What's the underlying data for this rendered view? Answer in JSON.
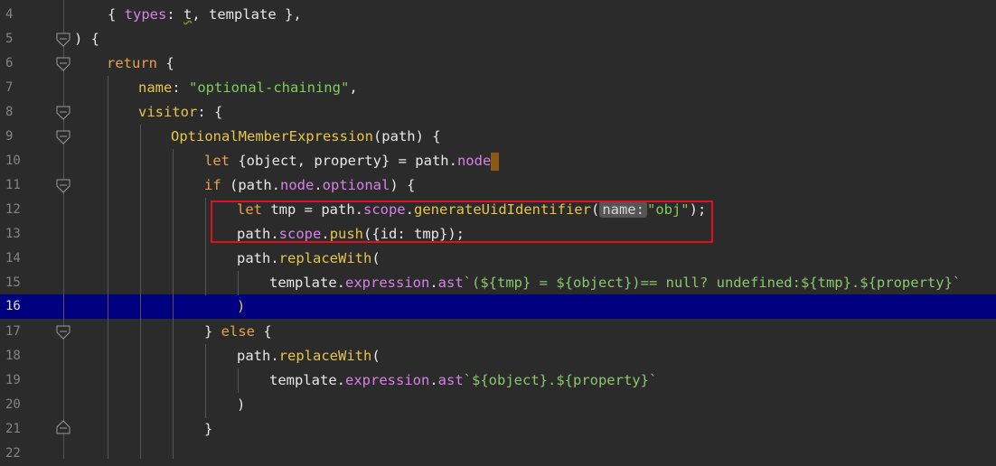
{
  "editor": {
    "current_line": "16",
    "highlight": "red box around lines 12-13"
  },
  "lines": [
    {
      "n": "4"
    },
    {
      "n": "5"
    },
    {
      "n": "6"
    },
    {
      "n": "7"
    },
    {
      "n": "8"
    },
    {
      "n": "9"
    },
    {
      "n": "10"
    },
    {
      "n": "11"
    },
    {
      "n": "12"
    },
    {
      "n": "13"
    },
    {
      "n": "14"
    },
    {
      "n": "15"
    },
    {
      "n": "16"
    },
    {
      "n": "17"
    },
    {
      "n": "18"
    },
    {
      "n": "19"
    },
    {
      "n": "20"
    },
    {
      "n": "21"
    },
    {
      "n": "22"
    }
  ],
  "code": {
    "l4": {
      "a": "{ ",
      "b": "types",
      "c": ": ",
      "d": "t",
      "e": ", template },"
    },
    "l5": {
      "a": ") {"
    },
    "l6": {
      "a": "return",
      "b": " {"
    },
    "l7": {
      "a": "name",
      "b": ": ",
      "c": "\"optional-chaining\"",
      "d": ","
    },
    "l8": {
      "a": "visitor",
      "b": ": {"
    },
    "l9": {
      "a": "OptionalMemberExpression",
      "b": "(path) {"
    },
    "l10": {
      "a": "let",
      "b": " {object, property} = path.",
      "c": "node"
    },
    "l11": {
      "a": "if",
      "b": " (path.",
      "c": "node",
      "d": ".",
      "e": "optional",
      "f": ") {"
    },
    "l12": {
      "a": "let",
      "b": " tmp = path.",
      "c": "scope",
      "d": ".",
      "e": "generateUidIdentifier",
      "f": "(",
      "hint": "name:",
      "g": "\"obj\"",
      "h": ");"
    },
    "l13": {
      "a": "path.",
      "b": "scope",
      "c": ".",
      "d": "push",
      "e": "({id: tmp});"
    },
    "l14": {
      "a": "path.",
      "b": "replaceWith",
      "c": "("
    },
    "l15": {
      "a": "template.",
      "b": "expression",
      "c": ".",
      "d": "ast",
      "e": "`(${tmp} = ${object})== null? undefined:${tmp}.${property}`"
    },
    "l16": {
      "a": ")"
    },
    "l17": {
      "a": "} ",
      "b": "else",
      "c": " {"
    },
    "l18": {
      "a": "path.",
      "b": "replaceWith",
      "c": "("
    },
    "l19": {
      "a": "template.",
      "b": "expression",
      "c": ".",
      "d": "ast",
      "e": "`${object}.${property}`"
    },
    "l20": {
      "a": ")"
    },
    "l21": {
      "a": "}"
    }
  }
}
